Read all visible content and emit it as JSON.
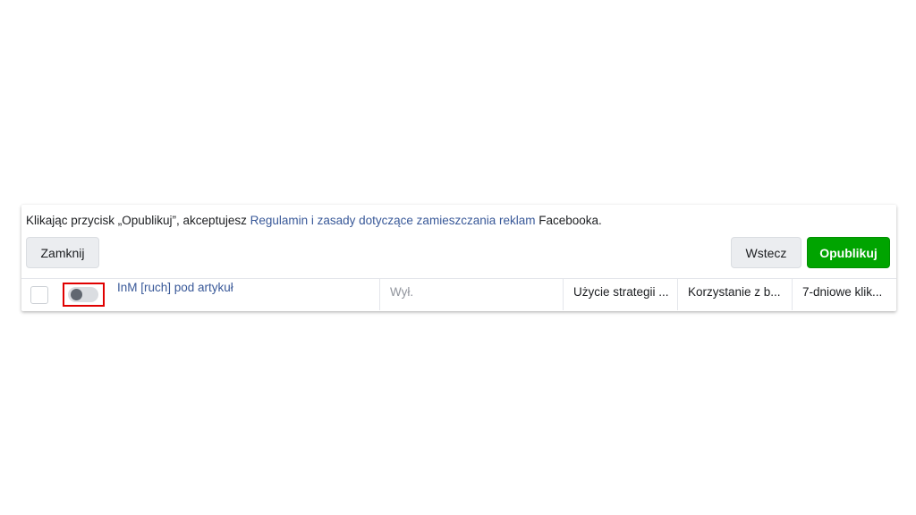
{
  "notice": {
    "prefix": "Klikając przycisk „Opublikuj”, akceptujesz ",
    "link": "Regulamin i zasady dotyczące zamieszczania reklam",
    "suffix": " Facebooka."
  },
  "buttons": {
    "close": "Zamknij",
    "back": "Wstecz",
    "publish": "Opublikuj"
  },
  "row": {
    "name": "InM [ruch] pod artykuł",
    "status": "Wył.",
    "strategy": "Użycie strategii ...",
    "use": "Korzystanie z b...",
    "window": "7-dniowe klik..."
  },
  "colors": {
    "publish": "#00a400",
    "link": "#385898",
    "highlight": "#e00000"
  }
}
